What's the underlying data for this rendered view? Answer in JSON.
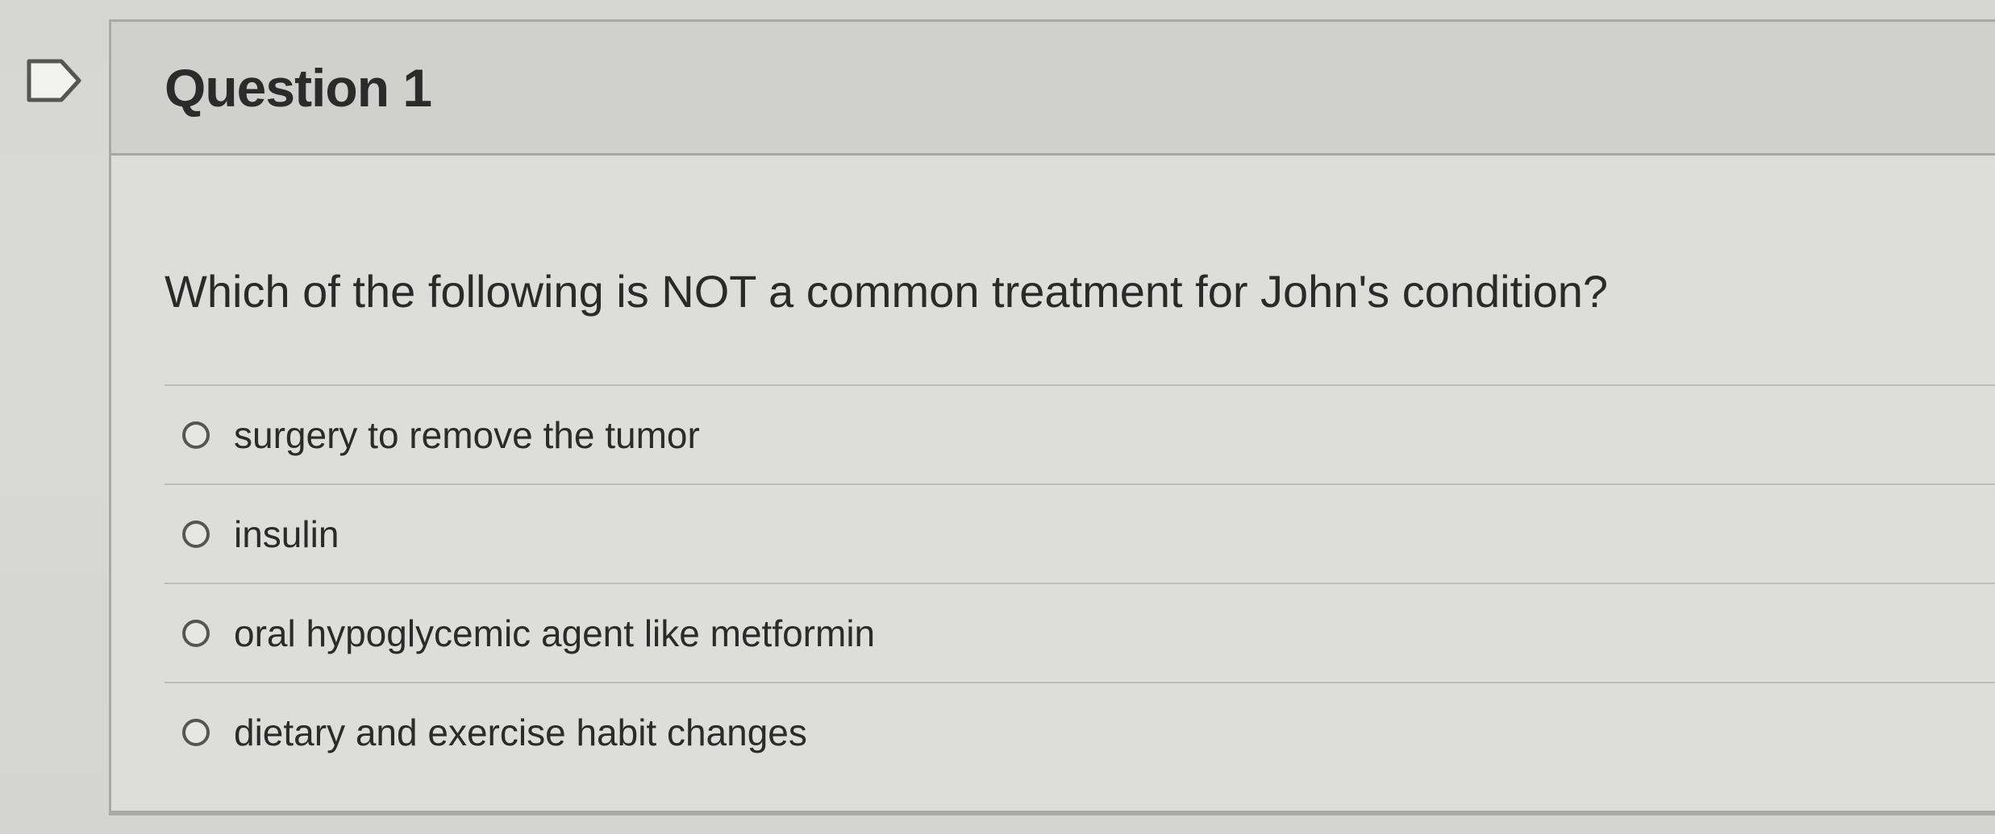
{
  "question": {
    "title": "Question 1",
    "text": "Which of the following is NOT a common treatment for John's condition?",
    "answers": [
      {
        "label": "surgery to remove the tumor",
        "selected": false
      },
      {
        "label": "insulin",
        "selected": false
      },
      {
        "label": "oral hypoglycemic agent like metformin",
        "selected": false
      },
      {
        "label": "dietary and exercise habit changes",
        "selected": false
      }
    ]
  },
  "icons": {
    "flag": "flag-icon"
  }
}
